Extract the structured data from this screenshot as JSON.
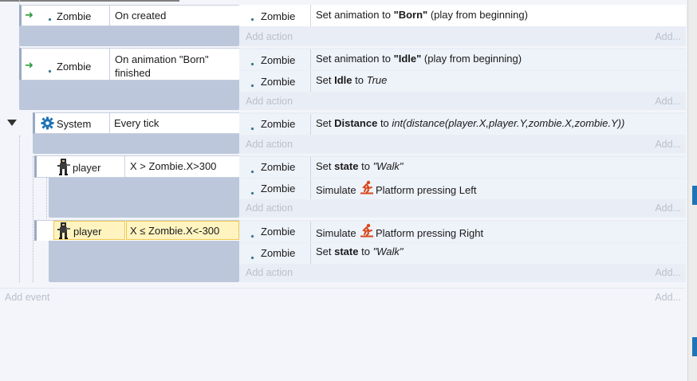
{
  "events": [
    {
      "condition_object": "Zombie",
      "condition_text": "On created",
      "actions": [
        {
          "object": "Zombie",
          "parts": [
            [
              "Set animation to ",
              ""
            ],
            [
              "\"Born\"",
              "bold"
            ],
            [
              " (play from beginning)",
              ""
            ]
          ]
        }
      ]
    },
    {
      "condition_object": "Zombie",
      "condition_text_line1": "On animation \"Born\"",
      "condition_text_line2": "finished",
      "actions": [
        {
          "object": "Zombie",
          "parts": [
            [
              "Set animation to ",
              ""
            ],
            [
              "\"Idle\"",
              "bold"
            ],
            [
              " (play from beginning)",
              ""
            ]
          ]
        },
        {
          "object": "Zombie",
          "parts": [
            [
              "Set ",
              ""
            ],
            [
              "Idle",
              "bold"
            ],
            [
              " to ",
              ""
            ],
            [
              "True",
              "ital"
            ]
          ]
        }
      ]
    },
    {
      "condition_object": "System",
      "condition_text": "Every tick",
      "actions": [
        {
          "object": "Zombie",
          "parts": [
            [
              "Set ",
              ""
            ],
            [
              "Distance",
              "bold"
            ],
            [
              " to ",
              ""
            ],
            [
              "int(distance(player.X,player.Y,zombie.X,zombie.Y))",
              "ital"
            ]
          ]
        }
      ]
    },
    {
      "condition_object": "player",
      "condition_text": "X > Zombie.X>300",
      "actions": [
        {
          "object": "Zombie",
          "parts": [
            [
              "Set ",
              ""
            ],
            [
              "state",
              "bold"
            ],
            [
              " to ",
              ""
            ],
            [
              "\"Walk\"",
              "ital"
            ]
          ]
        },
        {
          "object": "Zombie",
          "parts": [
            [
              "Simulate ",
              ""
            ],
            [
              "Platform pressing Left",
              ""
            ]
          ]
        }
      ]
    },
    {
      "condition_object": "player",
      "condition_text": "X ≤ Zombie.X<-300",
      "actions": [
        {
          "object": "Zombie",
          "parts": [
            [
              "Simulate ",
              ""
            ],
            [
              "Platform pressing Right",
              ""
            ]
          ]
        },
        {
          "object": "Zombie",
          "parts": [
            [
              "Set ",
              ""
            ],
            [
              "state",
              "bold"
            ],
            [
              " to ",
              ""
            ],
            [
              "\"Walk\"",
              "ital"
            ]
          ]
        }
      ]
    }
  ],
  "labels": {
    "add_action": "Add action",
    "add_right": "Add...",
    "add_event": "Add event"
  },
  "icons": {
    "trigger": "trigger-arrow-icon",
    "object_dot": "sprite-object-icon",
    "system": "gear-icon",
    "player": "player-sprite-icon",
    "platform": "platform-behavior-icon",
    "expander": "collapse-triangle-icon"
  },
  "colors": {
    "background": "#f3f5fa",
    "group_bar": "#bcc7db",
    "action_area": "#e9eef6",
    "selected_condition": "#fff4bf",
    "accent_blue": "#1f73b6",
    "trigger_green": "#2a9b3a",
    "platform_orange": "#d9471a"
  }
}
